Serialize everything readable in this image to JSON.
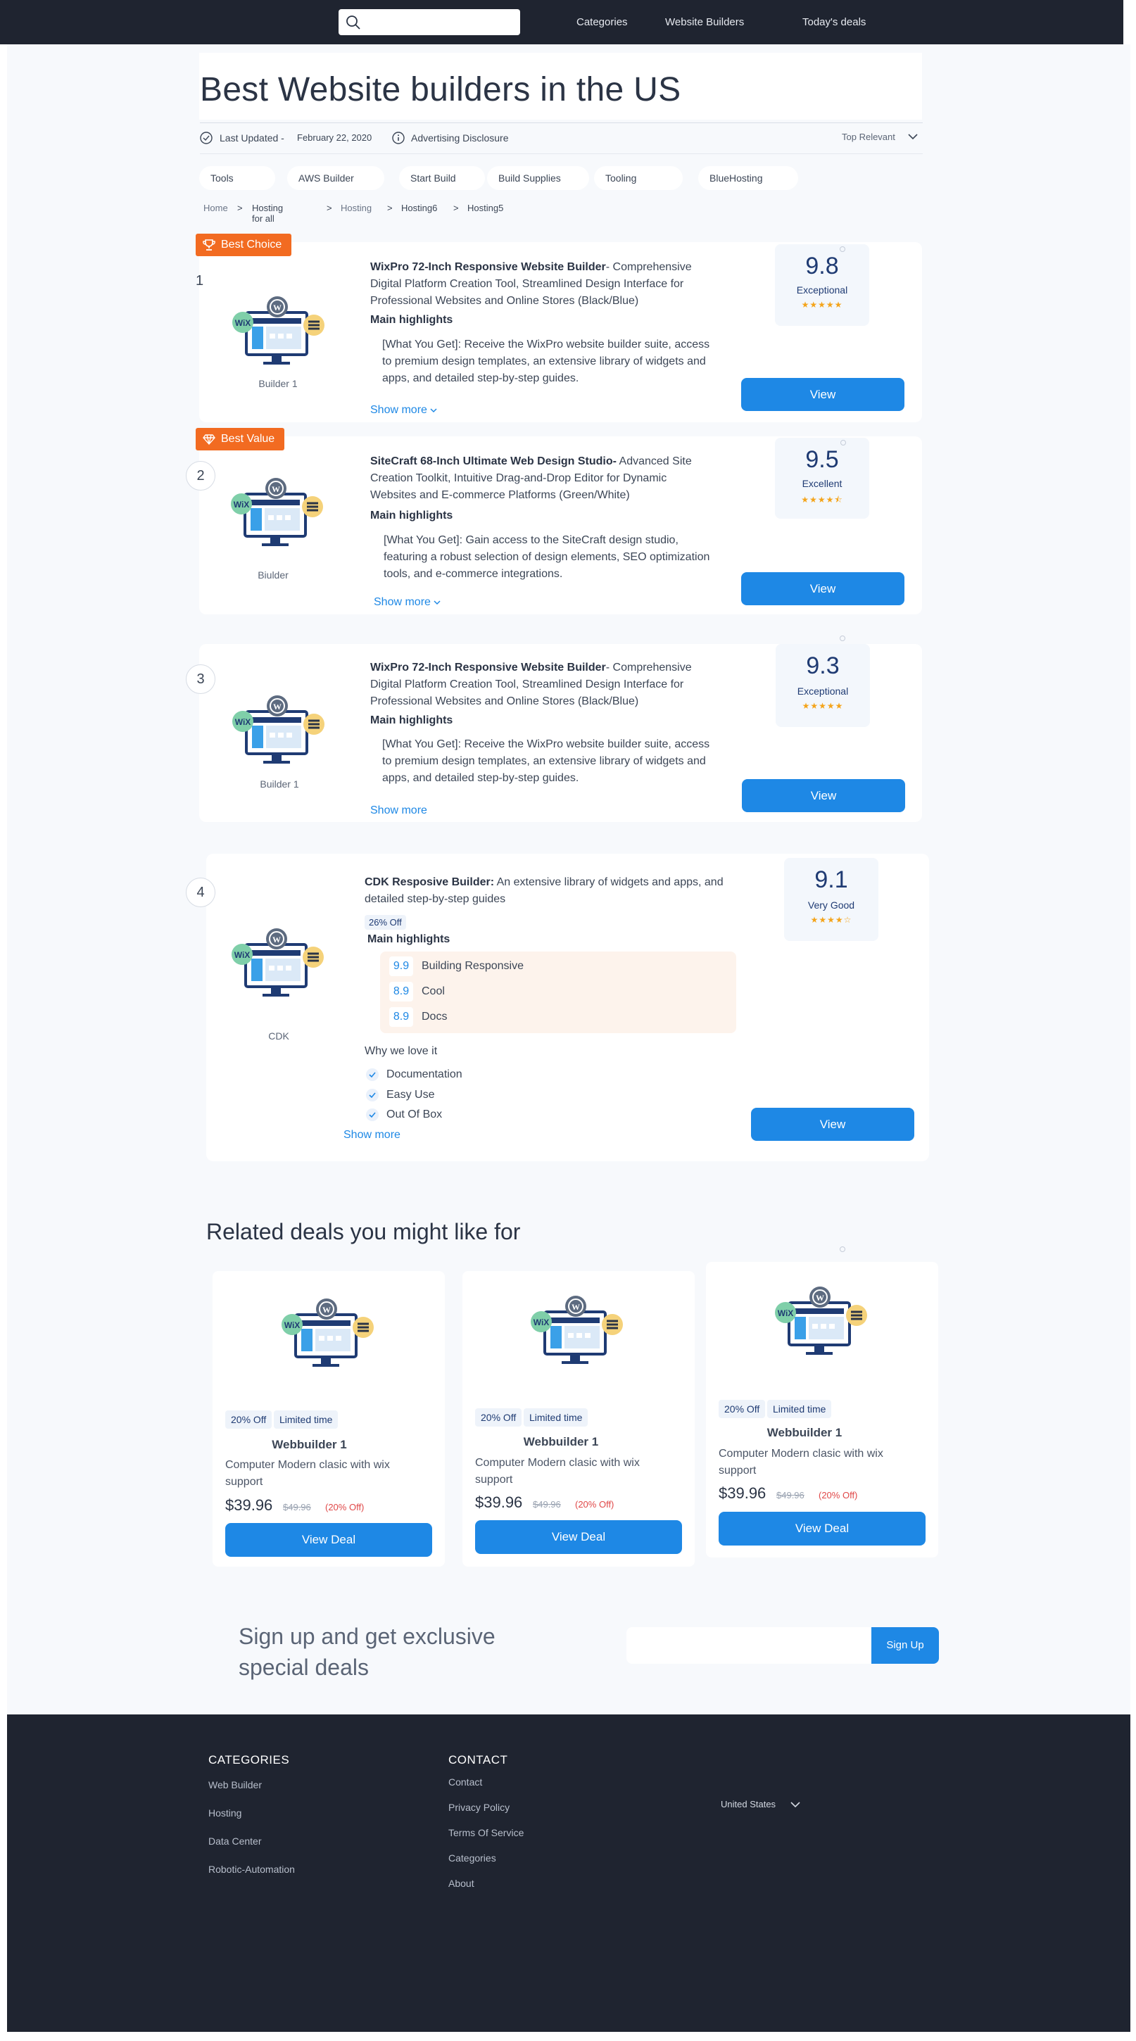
{
  "nav": {
    "search_placeholder": "",
    "links": [
      "Categories",
      "Website Builders",
      "Today's deals"
    ]
  },
  "page": {
    "title": "Best Website builders in the US",
    "last_updated_label": "Last Updated -",
    "last_updated_date": "February 22, 2020",
    "advertising": "Advertising Disclosure",
    "sort": "Top Relevant"
  },
  "chips": [
    "Tools",
    "AWS Builder",
    "Start Build",
    "Build Supplies",
    "Tooling",
    "BlueHosting"
  ],
  "breadcrumb": [
    "Home",
    "Hosting for all",
    "Hosting",
    "Hosting6",
    "Hosting5"
  ],
  "products": [
    {
      "rank": "1",
      "badge": "Best Choice",
      "caption": "Builder 1",
      "name": "WixPro 72-Inch Responsive Website Builder",
      "desc_line1": "- Comprehensive",
      "desc_rest": "Digital Platform Creation Tool, Streamlined Design Interface for Professional Websites and Online Stores (Black/Blue)",
      "highlights_label": "Main highlights",
      "highlight": "[What You Get]: Receive the WixPro website builder suite, access to premium design templates, an extensive library of widgets and apps, and detailed step-by-step guides.",
      "show_more": "Show more",
      "score": "9.8",
      "score_label": "Exceptional",
      "rating": 5,
      "stars": "★★★★★",
      "button": "View"
    },
    {
      "rank": "2",
      "badge": "Best Value",
      "caption": "Biulder",
      "name": "SiteCraft 68-Inch Ultimate Web Design Studio-",
      "desc_line1": " Advanced Site",
      "desc_rest": "Creation Toolkit, Intuitive Drag-and-Drop Editor for Dynamic Websites and E-commerce Platforms (Green/White)",
      "highlights_label": "Main highlights",
      "highlight": "[What You Get]: Gain access to the SiteCraft design studio, featuring a robust selection of design elements, SEO optimization tools, and e-commerce integrations.",
      "show_more": "Show more",
      "score": "9.5",
      "score_label": "Excellent",
      "rating": 4.5,
      "stars": "★★★★⯪",
      "button": "View"
    },
    {
      "rank": "3",
      "caption": "Builder 1",
      "name": "WixPro 72-Inch Responsive Website Builder",
      "desc_line1": "- Comprehensive",
      "desc_rest": "Digital Platform Creation Tool, Streamlined Design Interface for Professional Websites and Online Stores (Black/Blue)",
      "highlights_label": "Main highlights",
      "highlight": "[What You Get]: Receive the WixPro website builder suite, access to premium design templates, an extensive library of widgets and apps, and detailed step-by-step guides.",
      "show_more": "Show more",
      "score": "9.3",
      "score_label": "Exceptional",
      "rating": 5,
      "stars": "★★★★★",
      "button": "View"
    },
    {
      "rank": "4",
      "caption": "CDK",
      "name": "CDK Resposive Builder:",
      "desc_line1": " An extensive library of widgets and apps,",
      "desc_rest": "and detailed step-by-step guides",
      "discount": "26% Off",
      "highlights_label": "Main highlights",
      "scores": [
        {
          "value": "9.9",
          "label": "Building Responsive"
        },
        {
          "value": "8.9",
          "label": "Cool"
        },
        {
          "value": "8.9",
          "label": "Docs"
        }
      ],
      "why_label": "Why we love it",
      "why": [
        "Documentation",
        "Easy Use",
        "Out Of Box"
      ],
      "show_more": "Show more",
      "score": "9.1",
      "score_label": "Very Good",
      "rating": 4,
      "stars": "★★★★☆",
      "button": "View"
    }
  ],
  "related": {
    "title": "Related deals you might like for",
    "deals": [
      {
        "discount": "20% Off",
        "limited": "Limited time",
        "name": "Webbuilder 1",
        "desc": "Computer  Modern clasic with wix support",
        "price": "$39.96",
        "old_price": "$49.96",
        "off": "(20% Off)",
        "button": "View Deal"
      },
      {
        "discount": "20% Off",
        "limited": "Limited time",
        "name": "Webbuilder 1",
        "desc": "Computer  Modern clasic with wix support",
        "price": "$39.96",
        "old_price": "$49.96",
        "off": "(20% Off)",
        "button": "View Deal"
      },
      {
        "discount": "20% Off",
        "limited": "Limited time",
        "name": "Webbuilder 1",
        "desc": "Computer  Modern clasic with wix support",
        "price": "$39.96",
        "old_price": "$49.96",
        "off": "(20% Off)",
        "button": "View Deal"
      }
    ]
  },
  "signup": {
    "text_line1": "Sign up and get exclusive",
    "text_line2": "special deals",
    "email_placeholder": "",
    "button": "Sign Up"
  },
  "footer": {
    "categories_title": "CATEGORIES",
    "categories": [
      "Web Builder",
      "Hosting",
      "Data Center",
      "Robotic-Automation"
    ],
    "contact_title": "CONTACT",
    "contact": [
      "Contact",
      "Privacy Policy",
      "Terms Of Service",
      "Categories",
      "About"
    ],
    "country": "United States"
  },
  "colors": {
    "accent": "#1e88e5",
    "badge": "#f26b21",
    "dark": "#1f2430",
    "star": "#f4a41a"
  }
}
